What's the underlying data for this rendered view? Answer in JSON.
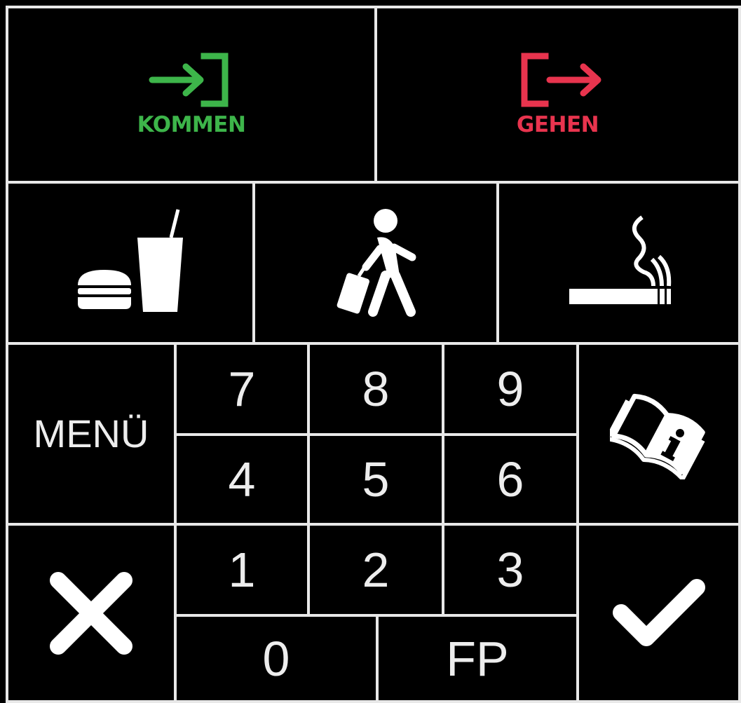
{
  "colors": {
    "background": "#000000",
    "grid": "#e8e8e8",
    "kommen": "#3db54a",
    "gehen": "#e8344e",
    "foreground": "#ffffff"
  },
  "kommen": {
    "label": "KOMMEN",
    "icon": "enter-arrow-icon"
  },
  "gehen": {
    "label": "GEHEN",
    "icon": "exit-arrow-icon"
  },
  "status_buttons": [
    {
      "name": "pause-button",
      "icon": "food-drink-icon"
    },
    {
      "name": "business-trip-button",
      "icon": "traveler-icon"
    },
    {
      "name": "smoke-break-button",
      "icon": "cigarette-icon"
    }
  ],
  "menu": {
    "label": "MENÜ"
  },
  "info": {
    "icon": "info-book-icon"
  },
  "keypad": {
    "k7": "7",
    "k8": "8",
    "k9": "9",
    "k4": "4",
    "k5": "5",
    "k6": "6",
    "k1": "1",
    "k2": "2",
    "k3": "3",
    "k0": "0",
    "fp": "FP"
  },
  "cancel": {
    "icon": "close-x-icon"
  },
  "confirm": {
    "icon": "checkmark-icon"
  }
}
